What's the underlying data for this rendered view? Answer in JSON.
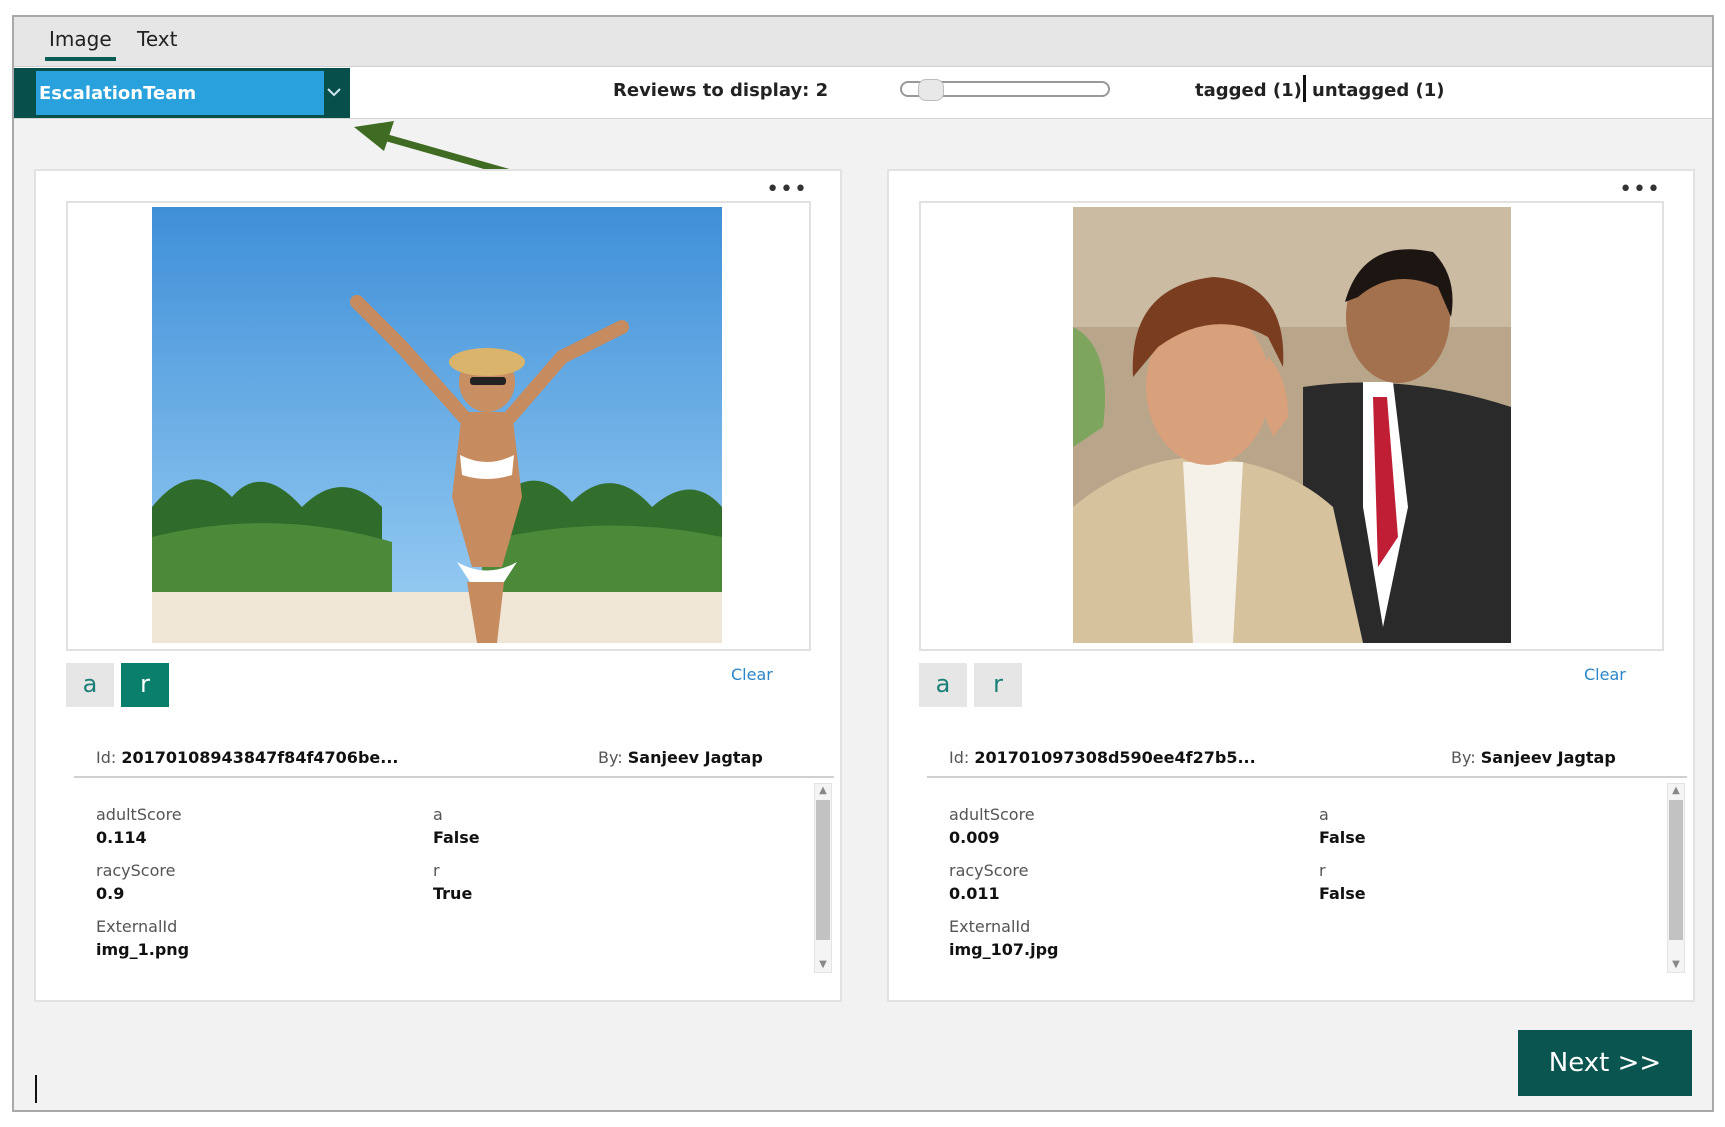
{
  "tabs": [
    {
      "label": "Image",
      "active": true
    },
    {
      "label": "Text",
      "active": false
    }
  ],
  "toolbar": {
    "team": "EscalationTeam",
    "reviews_label": "Reviews to display: 2",
    "reviews_count": 2,
    "tagged_label": "tagged (1)",
    "untagged_label": "untagged (1)"
  },
  "colors": {
    "accent_dark": "#064f4b",
    "dropdown_blue": "#28a1dc",
    "tag_active": "#0a7f6c",
    "annotation_arrow": "#3f6b22"
  },
  "cards": [
    {
      "tag_a_label": "a",
      "tag_r_label": "r",
      "active_tag": "r",
      "clear_label": "Clear",
      "id_key": "Id:",
      "id_value": "20170108943847f84f4706be...",
      "by_key": "By:",
      "by_value": "Sanjeev Jagtap",
      "fields": [
        {
          "key": "adultScore",
          "value": "0.114"
        },
        {
          "key": "a",
          "value": "False"
        },
        {
          "key": "racyScore",
          "value": "0.9"
        },
        {
          "key": "r",
          "value": "True"
        },
        {
          "key": "ExternalId",
          "value": "img_1.png"
        }
      ]
    },
    {
      "tag_a_label": "a",
      "tag_r_label": "r",
      "active_tag": "",
      "clear_label": "Clear",
      "id_key": "Id:",
      "id_value": "201701097308d590ee4f27b5...",
      "by_key": "By:",
      "by_value": "Sanjeev Jagtap",
      "fields": [
        {
          "key": "adultScore",
          "value": "0.009"
        },
        {
          "key": "a",
          "value": "False"
        },
        {
          "key": "racyScore",
          "value": "0.011"
        },
        {
          "key": "r",
          "value": "False"
        },
        {
          "key": "ExternalId",
          "value": "img_107.jpg"
        }
      ]
    }
  ],
  "next_label": "Next >>"
}
